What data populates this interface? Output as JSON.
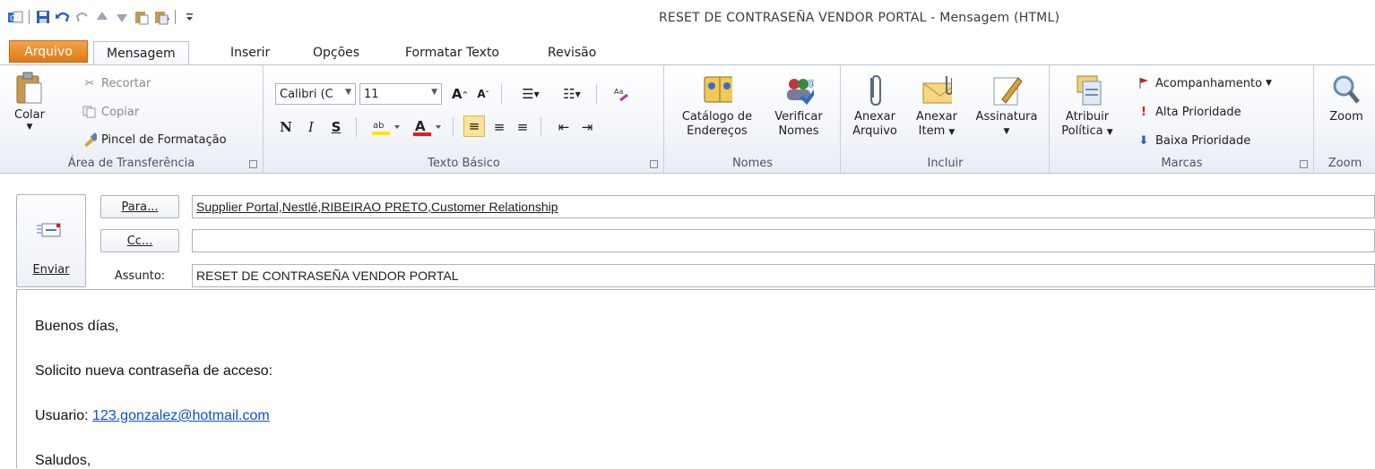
{
  "window": {
    "title": "RESET DE CONTRASEÑA VENDOR PORTAL  -  Mensagem (HTML)"
  },
  "quick_access": {
    "icons": [
      "outlook-icon",
      "save-icon",
      "undo-icon",
      "redo-icon",
      "up-arrow-icon",
      "down-arrow-icon",
      "paste-icon",
      "paste-special-icon",
      "customize-icon"
    ]
  },
  "tabs": [
    {
      "label": "Arquivo"
    },
    {
      "label": "Mensagem"
    },
    {
      "label": "Inserir"
    },
    {
      "label": "Opções"
    },
    {
      "label": "Formatar Texto"
    },
    {
      "label": "Revisão"
    }
  ],
  "clipboard": {
    "paste": "Colar",
    "cut": "Recortar",
    "copy": "Copiar",
    "format_painter": "Pincel de Formatação",
    "group": "Área de Transferência"
  },
  "basic_text": {
    "font": "Calibri (C",
    "size": "11",
    "bold": "N",
    "italic": "I",
    "underline": "S",
    "group": "Texto Básico"
  },
  "names": {
    "address_book_1": "Catálogo de",
    "address_book_2": "Endereços",
    "check_names_1": "Verificar",
    "check_names_2": "Nomes",
    "group": "Nomes"
  },
  "include": {
    "attach_file_1": "Anexar",
    "attach_file_2": "Arquivo",
    "attach_item_1": "Anexar",
    "attach_item_2": "Item",
    "signature": "Assinatura",
    "group": "Incluir"
  },
  "tags": {
    "assign_policy_1": "Atribuir",
    "assign_policy_2": "Política",
    "follow_up": "Acompanhamento",
    "high_priority": "Alta Prioridade",
    "low_priority": "Baixa Prioridade",
    "group": "Marcas"
  },
  "zoom": {
    "label": "Zoom",
    "group": "Zoom"
  },
  "compose": {
    "send": "Enviar",
    "to_button": "Para...",
    "cc_button": "Cc...",
    "subject_label": "Assunto:",
    "to_value": "Supplier Portal,Nestlé,RIBEIRAO PRETO,Customer Relationship",
    "cc_value": "",
    "subject_value": "RESET DE CONTRASEÑA VENDOR PORTAL"
  },
  "body": {
    "greeting": "Buenos días,",
    "request": "Solicito nueva contraseña de acceso:",
    "user_label": "Usuario: ",
    "user_email": "123.gonzalez@hotmail.com",
    "closing": "Saludos,"
  },
  "colors": {
    "file_tab": "#e17a14",
    "highlight": "#fbe29a",
    "link": "#0b4fd6",
    "font_color_bar": "#e02020",
    "highlight_bar": "#ffe600"
  }
}
